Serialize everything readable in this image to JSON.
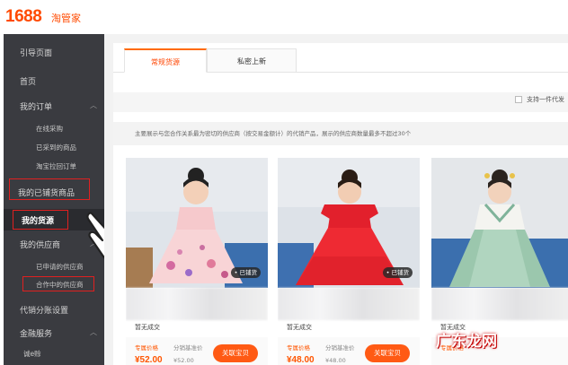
{
  "header": {
    "logo": "1688",
    "logo_sub": "淘管家"
  },
  "sidebar": {
    "items": [
      {
        "label": "引导页面"
      },
      {
        "label": "首页"
      },
      {
        "label": "我的订单"
      },
      {
        "label": "在线采购"
      },
      {
        "label": "已采到的商品"
      },
      {
        "label": "淘宝拉回订单"
      },
      {
        "label": "我的已铺货商品"
      },
      {
        "label": "我的货源"
      },
      {
        "label": "我的供应商"
      },
      {
        "label": "已申请的供应商"
      },
      {
        "label": "合作中的供应商"
      },
      {
        "label": "代销分账设置"
      },
      {
        "label": "金融服务"
      },
      {
        "label": "诚e赊"
      }
    ]
  },
  "tabs": [
    {
      "label": "常规货源"
    },
    {
      "label": "私密上新"
    }
  ],
  "filter": {
    "label": "支持一件代发"
  },
  "notice": "主要展示与您合作关系最为密切的供应商（按交易金额计）的代销产品，展示的供应商数量最多不超过30个",
  "products": [
    {
      "badge": "• 已铺货",
      "title": "暂无成交",
      "price_label": "专属价格",
      "price": "¥52.00",
      "dist_label": "分销基准价",
      "dist_price": "¥52.00",
      "button": "关联宝贝"
    },
    {
      "badge": "• 已铺货",
      "title": "暂无成交",
      "price_label": "专属价格",
      "price": "¥48.00",
      "dist_label": "分销基准价",
      "dist_price": "¥48.00",
      "button": "关联宝贝"
    },
    {
      "badge": "",
      "title": "暂无成交",
      "price_label": "专属价格",
      "price": "",
      "dist_label": "",
      "dist_price": "",
      "button": ""
    }
  ],
  "watermark": "广东龙网",
  "colors": {
    "accent": "#ff5a14",
    "sidebar_bg": "#3a3b40",
    "highlight_box": "#e02020",
    "brand": "#ff4a00"
  },
  "icons": [
    "chevron-up-icon",
    "chevron-down-icon",
    "pointing-hand-icon",
    "checkbox-icon"
  ]
}
